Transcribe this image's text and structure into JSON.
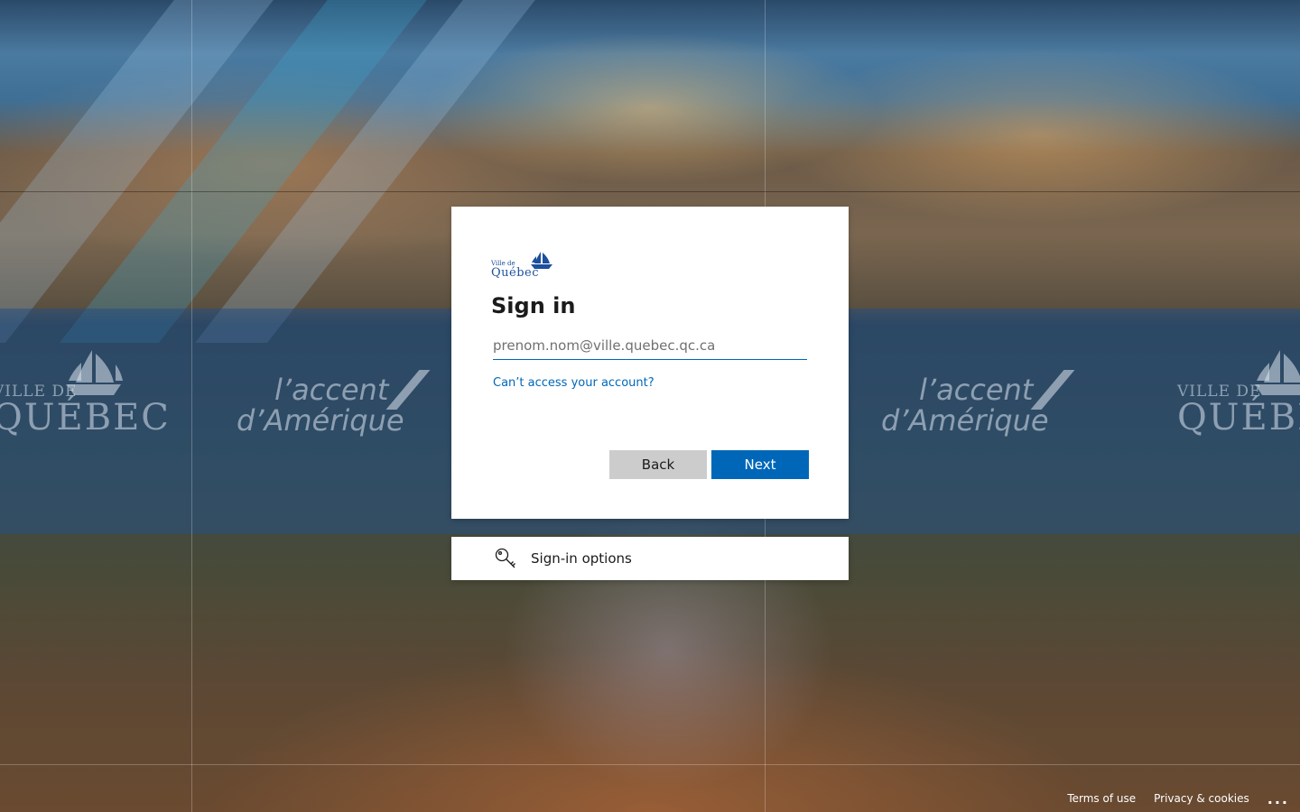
{
  "brand": {
    "logo_small": "Ville de",
    "logo_big": "Québec",
    "bg_brand_small": "VILLE DE",
    "bg_brand_big": "QUÉBEC",
    "bg_accent_line1": "l’accent",
    "bg_accent_line2": "d’Amérique"
  },
  "signin": {
    "title": "Sign in",
    "email_placeholder": "prenom.nom@ville.quebec.qc.ca",
    "email_value": "",
    "cant_access_link": "Can’t access your account?",
    "back_label": "Back",
    "next_label": "Next"
  },
  "options": {
    "label": "Sign-in options",
    "icon": "key-icon"
  },
  "footer": {
    "terms": "Terms of use",
    "privacy": "Privacy & cookies",
    "more": "..."
  },
  "colors": {
    "accent": "#0067b8",
    "brand": "#1c4f9c",
    "back_button": "#cccccc",
    "card": "#ffffff"
  }
}
